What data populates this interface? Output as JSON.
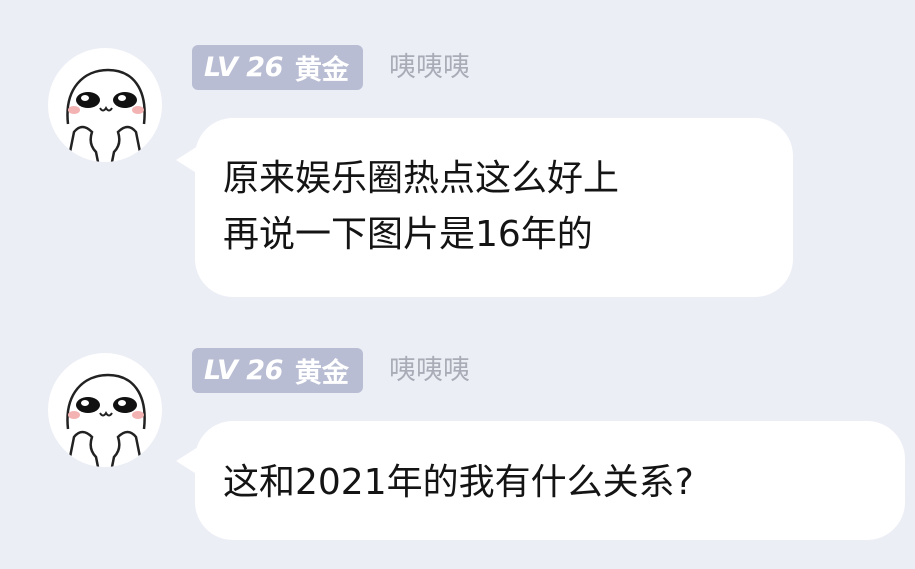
{
  "messages": [
    {
      "badge_level": "LV 26",
      "badge_tier": "黄金",
      "username": "咦咦咦",
      "lines": [
        "原来娱乐圈热点这么好上",
        "再说一下图片是16年的"
      ]
    },
    {
      "badge_level": "LV 26",
      "badge_tier": "黄金",
      "username": "咦咦咦",
      "lines": [
        "这和2021年的我有什么关系?"
      ]
    }
  ],
  "colors": {
    "background": "#eceef6",
    "bubble": "#ffffff",
    "badge": "#b9bdd3",
    "username": "#a9acb6",
    "text": "#141414"
  },
  "icons": [
    "avatar-cartoon-face-icon"
  ]
}
